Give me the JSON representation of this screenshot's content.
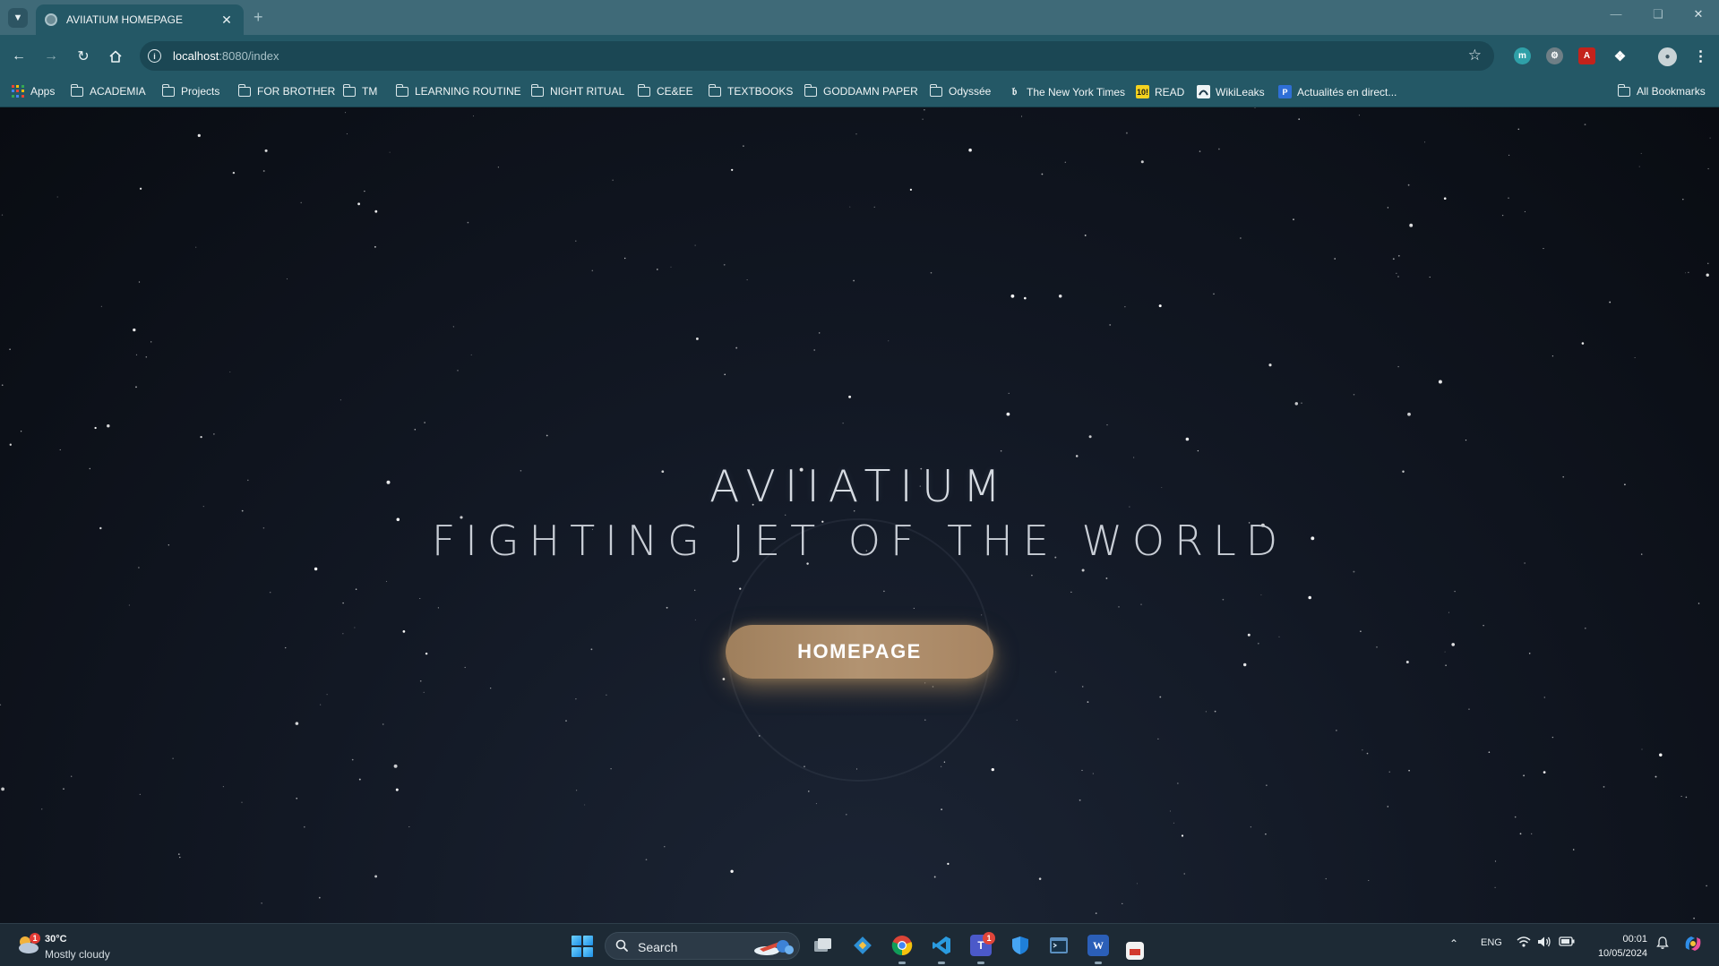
{
  "browser": {
    "tab_title": "AVIIATIUM HOMEPAGE",
    "url_host": "localhost",
    "url_path": ":8080/index",
    "bookmarks": [
      {
        "label": "Apps",
        "icon": "apps-grid-icon"
      },
      {
        "label": "ACADEMIA",
        "icon": "folder-icon"
      },
      {
        "label": "Projects",
        "icon": "folder-icon"
      },
      {
        "label": "FOR BROTHER",
        "icon": "folder-icon"
      },
      {
        "label": "TM",
        "icon": "folder-icon"
      },
      {
        "label": "LEARNING ROUTINE",
        "icon": "folder-icon"
      },
      {
        "label": "NIGHT RITUAL",
        "icon": "folder-icon"
      },
      {
        "label": "CE&EE",
        "icon": "folder-icon"
      },
      {
        "label": "TEXTBOOKS",
        "icon": "folder-icon"
      },
      {
        "label": "GODDAMN PAPER",
        "icon": "folder-icon"
      },
      {
        "label": "Odyssée",
        "icon": "folder-icon"
      },
      {
        "label": "The New York Times",
        "icon": "nyt-favicon"
      },
      {
        "label": "READ",
        "icon": "read-favicon"
      },
      {
        "label": "WikiLeaks",
        "icon": "wikileaks-favicon"
      },
      {
        "label": "Actualités en direct...",
        "icon": "news-favicon"
      }
    ],
    "all_bookmarks_label": "All Bookmarks",
    "favicon_text": {
      "read": "10!",
      "news": "P"
    }
  },
  "hero": {
    "title": "AVIIATIUM",
    "subtitle": "FIGHTING JET OF THE WORLD",
    "cta_label": "HOMEPAGE",
    "cta_color": "#b08f6c"
  },
  "taskbar": {
    "weather_temp": "30°C",
    "weather_desc": "Mostly cloudy",
    "weather_badge": "1",
    "search_label": "Search",
    "teams_badge": "1",
    "word_glyph": "W",
    "lang": "ENG",
    "time": "00:01",
    "date": "10/05/2024"
  }
}
